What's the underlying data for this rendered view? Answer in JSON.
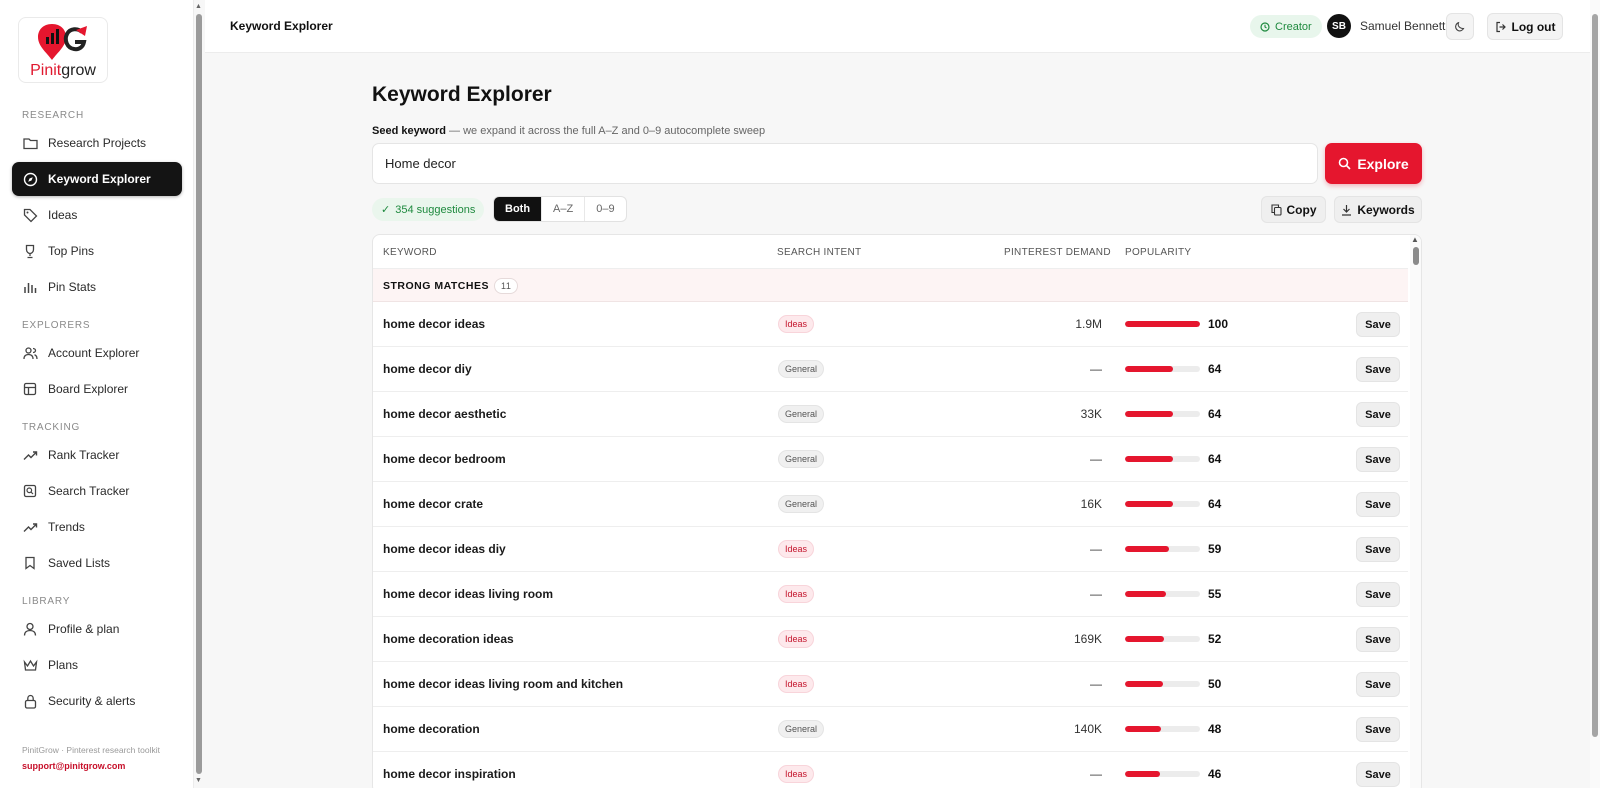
{
  "sidebar": {
    "logo": {
      "part1": "Pinit",
      "part2": "grow"
    },
    "sections": [
      {
        "label": "RESEARCH"
      },
      {
        "label": "EXPLORERS"
      },
      {
        "label": "TRACKING"
      },
      {
        "label": "LIBRARY"
      }
    ],
    "items": [
      {
        "label": "Research Projects",
        "icon": "folder-icon"
      },
      {
        "label": "Keyword Explorer",
        "icon": "compass-icon",
        "active": true
      },
      {
        "label": "Ideas",
        "icon": "tag-icon"
      },
      {
        "label": "Top Pins",
        "icon": "trophy-icon"
      },
      {
        "label": "Pin Stats",
        "icon": "bar-chart-icon"
      },
      {
        "label": "Account Explorer",
        "icon": "users-icon"
      },
      {
        "label": "Board Explorer",
        "icon": "board-icon"
      },
      {
        "label": "Rank Tracker",
        "icon": "trending-icon"
      },
      {
        "label": "Search Tracker",
        "icon": "search-square-icon"
      },
      {
        "label": "Trends",
        "icon": "trend-line-icon"
      },
      {
        "label": "Saved Lists",
        "icon": "bookmark-icon"
      },
      {
        "label": "Profile & plan",
        "icon": "user-icon"
      },
      {
        "label": "Plans",
        "icon": "crown-icon"
      },
      {
        "label": "Security & alerts",
        "icon": "lock-icon"
      }
    ],
    "footer": {
      "tagline": "PinitGrow · Pinterest research toolkit",
      "email": "support@pinitgrow.com"
    }
  },
  "header": {
    "title": "Keyword Explorer",
    "plan": "Creator",
    "user_initials": "SB",
    "user_name": "Samuel Bennett",
    "logout": "Log out"
  },
  "main": {
    "title": "Keyword Explorer",
    "seed_label_bold": "Seed keyword",
    "seed_label_rest": " — we expand it across the full A–Z and 0–9 autocomplete sweep",
    "search_value": "Home decor",
    "explore_label": "Explore",
    "suggestions": "354 suggestions",
    "filters": [
      "Both",
      "A–Z",
      "0–9"
    ],
    "active_filter": "Both",
    "copy_label": "Copy",
    "keywords_label": "Keywords"
  },
  "table": {
    "columns": {
      "keyword": "KEYWORD",
      "intent": "SEARCH INTENT",
      "demand": "PINTEREST DEMAND",
      "popularity": "POPULARITY"
    },
    "group": {
      "label": "STRONG MATCHES",
      "count": "11"
    },
    "save_label": "Save",
    "rows": [
      {
        "keyword": "home decor ideas",
        "intent": "Ideas",
        "demand": "1.9M",
        "popularity": 100
      },
      {
        "keyword": "home decor diy",
        "intent": "General",
        "demand": "—",
        "popularity": 64
      },
      {
        "keyword": "home decor aesthetic",
        "intent": "General",
        "demand": "33K",
        "popularity": 64
      },
      {
        "keyword": "home decor bedroom",
        "intent": "General",
        "demand": "—",
        "popularity": 64
      },
      {
        "keyword": "home decor crate",
        "intent": "General",
        "demand": "16K",
        "popularity": 64
      },
      {
        "keyword": "home decor ideas diy",
        "intent": "Ideas",
        "demand": "—",
        "popularity": 59
      },
      {
        "keyword": "home decor ideas living room",
        "intent": "Ideas",
        "demand": "—",
        "popularity": 55
      },
      {
        "keyword": "home decoration ideas",
        "intent": "Ideas",
        "demand": "169K",
        "popularity": 52
      },
      {
        "keyword": "home decor ideas living room and kitchen",
        "intent": "Ideas",
        "demand": "—",
        "popularity": 50
      },
      {
        "keyword": "home decoration",
        "intent": "General",
        "demand": "140K",
        "popularity": 48
      },
      {
        "keyword": "home decor inspiration",
        "intent": "Ideas",
        "demand": "—",
        "popularity": 46
      }
    ]
  },
  "colors": {
    "accent": "#e5162e",
    "active_nav": "#141414",
    "success": "#1f8a3f"
  }
}
